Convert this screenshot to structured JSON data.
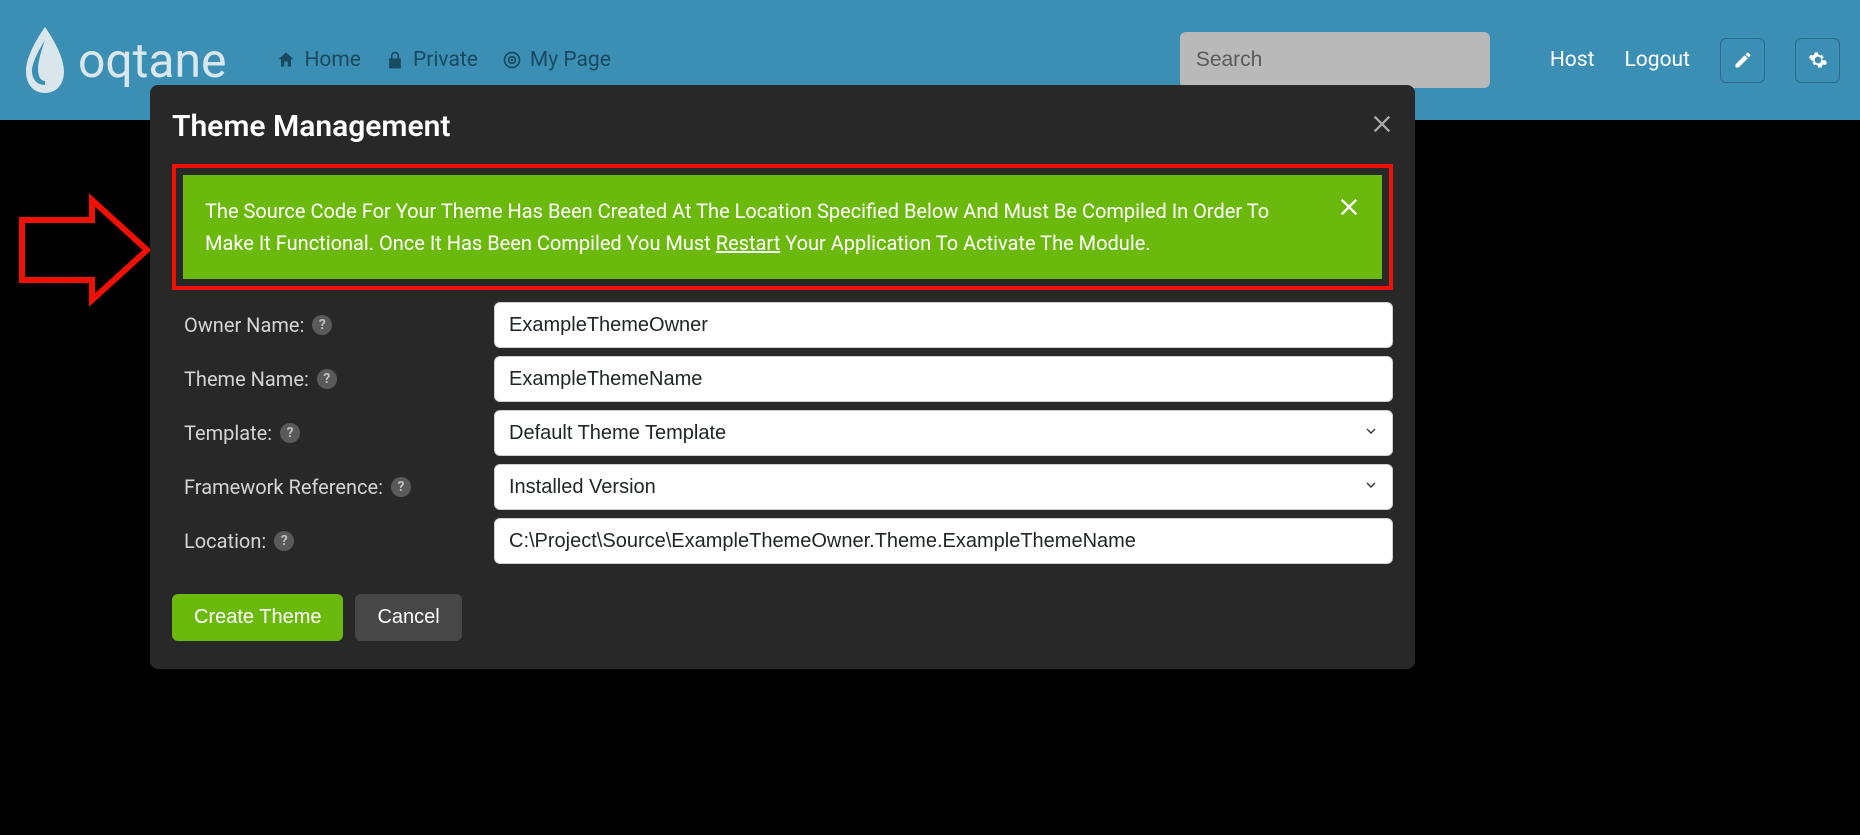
{
  "header": {
    "brand_text": "oqtane",
    "nav": [
      {
        "label": "Home",
        "icon": "home-icon"
      },
      {
        "label": "Private",
        "icon": "lock-icon"
      },
      {
        "label": "My Page",
        "icon": "target-icon"
      }
    ],
    "search_placeholder": "Search",
    "user_label": "Host",
    "logout_label": "Logout"
  },
  "modal": {
    "title": "Theme Management",
    "alert": {
      "text_before_link": "The Source Code For Your Theme Has Been Created At The Location Specified Below And Must Be Compiled In Order To Make It Functional. Once It Has Been Compiled You Must ",
      "link_text": "Restart",
      "text_after_link": " Your Application To Activate The Module."
    },
    "fields": {
      "owner_name": {
        "label": "Owner Name:",
        "value": "ExampleThemeOwner"
      },
      "theme_name": {
        "label": "Theme Name:",
        "value": "ExampleThemeName"
      },
      "template": {
        "label": "Template:",
        "value": "Default Theme Template"
      },
      "framework": {
        "label": "Framework Reference:",
        "value": "Installed Version"
      },
      "location": {
        "label": "Location:",
        "value": "C:\\Project\\Source\\ExampleThemeOwner.Theme.ExampleThemeName"
      }
    },
    "actions": {
      "create": "Create Theme",
      "cancel": "Cancel"
    }
  }
}
